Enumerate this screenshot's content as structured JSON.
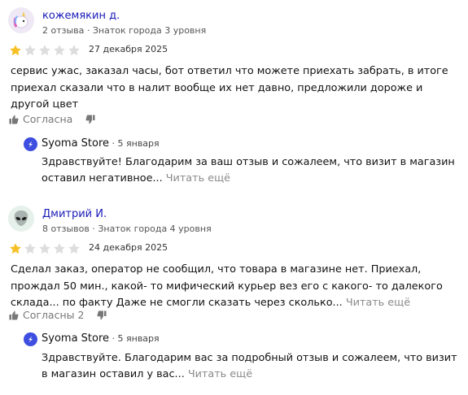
{
  "colors": {
    "star_filled": "#f6c026",
    "star_empty": "#dddddd",
    "author_link": "#1a1ab8",
    "read_more": "#8a8a8a",
    "reply_logo": "#3d4ee0"
  },
  "reviews": [
    {
      "author": "кожемякин д.",
      "avatar_icon": "unicorn-icon",
      "meta": "2 отзыва · Знаток города 3 уровня",
      "rating": 1,
      "rating_max": 5,
      "date": "27 декабря 2025",
      "text": "сервис ужас, заказал часы, бот ответил что можете приехать забрать, в итоге приехал сказали что в налит вообще их нет давно, предложили дороже и другой цвет",
      "text_more": "",
      "agree_label": "Согласна",
      "reply": {
        "name": "Syoma Store",
        "date": " · 5 января",
        "text": "Здравствуйте! Благодарим за ваш отзыв и сожалеем, что визит в магазин оставил негативное...",
        "read_more": "Читать ещё"
      }
    },
    {
      "author": "Дмитрий И.",
      "avatar_icon": "alien-icon",
      "meta": "8 отзывов · Знаток города 4 уровня",
      "rating": 1,
      "rating_max": 5,
      "date": "24 декабря 2025",
      "text": "Сделал заказ, оператор не сообщил, что товара в магазине нет. Приехал, прождал 50 мин., какой- то мифический курьер вез его с какого- то далекого склада... по факту Даже не смогли сказать через сколько...",
      "text_more": "Читать ещё",
      "agree_label": "Согласны 2",
      "reply": {
        "name": "Syoma Store",
        "date": " · 5 января",
        "text": "Здравствуйте. Благодарим вас за подробный отзыв и сожалеем, что визит в магазин оставил у вас...",
        "read_more": "Читать ещё"
      }
    }
  ]
}
